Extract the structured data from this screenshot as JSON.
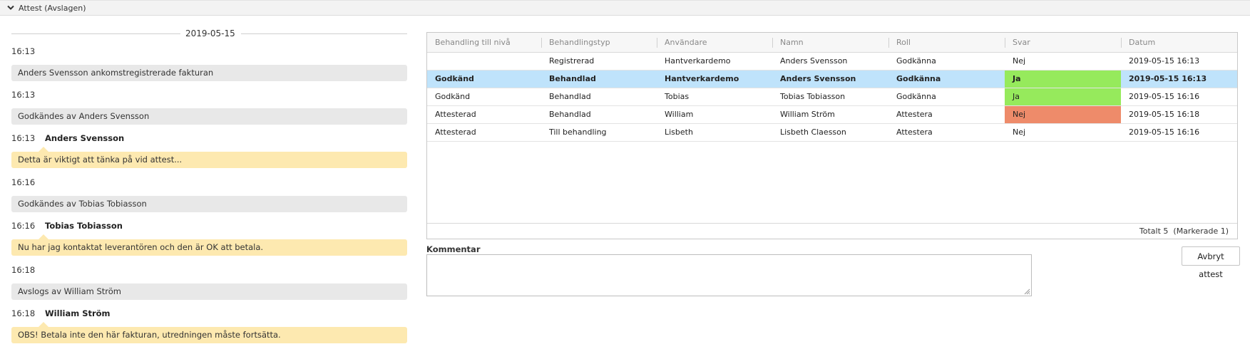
{
  "header": {
    "title": "Attest (Avslagen)"
  },
  "timeline": {
    "date": "2019-05-15",
    "entries": [
      {
        "time": "16:13",
        "event": "Anders Svensson ankomstregistrerade fakturan"
      },
      {
        "time": "16:13",
        "event": "Godkändes av Anders Svensson"
      },
      {
        "time": "16:13",
        "name": "Anders Svensson",
        "comment": "Detta är viktigt att tänka på vid attest..."
      },
      {
        "time": "16:16",
        "event": "Godkändes av Tobias Tobiasson"
      },
      {
        "time": "16:16",
        "name": "Tobias Tobiasson",
        "comment": "Nu har jag kontaktat leverantören och den är OK att betala."
      },
      {
        "time": "16:18",
        "event": "Avslogs av William Ström"
      },
      {
        "time": "16:18",
        "name": "William Ström",
        "comment": "OBS! Betala inte den här fakturan, utredningen måste fortsätta."
      }
    ]
  },
  "grid": {
    "columns": [
      "Behandling till nivå",
      "Behandlingstyp",
      "Användare",
      "Namn",
      "Roll",
      "Svar",
      "Datum"
    ],
    "rows": [
      [
        "",
        "Registrerad",
        "Hantverkardemo",
        "Anders Svensson",
        "Godkänna",
        "Nej",
        "2019-05-15 16:13"
      ],
      [
        "Godkänd",
        "Behandlad",
        "Hantverkardemo",
        "Anders Svensson",
        "Godkänna",
        "Ja",
        "2019-05-15 16:13"
      ],
      [
        "Godkänd",
        "Behandlad",
        "Tobias",
        "Tobias Tobiasson",
        "Godkänna",
        "Ja",
        "2019-05-15 16:16"
      ],
      [
        "Attesterad",
        "Behandlad",
        "William",
        "William Ström",
        "Attestera",
        "Nej",
        "2019-05-15 16:18"
      ],
      [
        "Attesterad",
        "Till behandling",
        "Lisbeth",
        "Lisbeth Claesson",
        "Attestera",
        "Nej",
        "2019-05-15 16:16"
      ]
    ],
    "svar_colors": [
      "",
      "#96ea5c",
      "#96ea5c",
      "#ee8b6a",
      ""
    ],
    "selected_row": 1,
    "total_text": "Totalt 5",
    "marked_text": "(Markerade 1)"
  },
  "comment": {
    "label": "Kommentar",
    "value": ""
  },
  "actions": {
    "cancel_label": "Avbryt attest"
  }
}
